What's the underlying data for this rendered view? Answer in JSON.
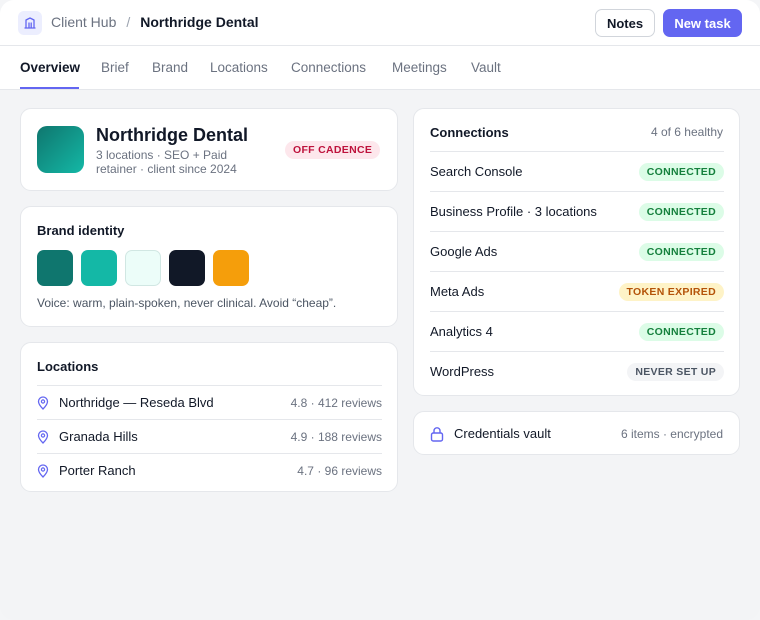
{
  "header": {
    "app_name": "Client Hub",
    "separator": "/",
    "client_name": "Northridge Dental",
    "notes_label": "Notes",
    "new_task_label": "New task"
  },
  "tabs": [
    {
      "label": "Overview",
      "active": true
    },
    {
      "label": "Brief",
      "active": false
    },
    {
      "label": "Brand",
      "active": false
    },
    {
      "label": "Locations",
      "active": false
    },
    {
      "label": "Connections",
      "active": false
    },
    {
      "label": "Meetings",
      "active": false
    },
    {
      "label": "Vault",
      "active": false
    }
  ],
  "profile": {
    "name": "Northridge Dental",
    "subtitle_line1": "3 locations · SEO + Paid",
    "subtitle_line2": "retainer · client since 2024",
    "status": "OFF CADENCE",
    "avatar_colors": [
      "#0f766e",
      "#14b8a6"
    ]
  },
  "brand": {
    "title": "Brand identity",
    "swatches": [
      "#0f766e",
      "#14b8a6",
      "#ecfdf9",
      "#111827",
      "#f59e0b"
    ],
    "voice": "Voice: warm, plain-spoken, never clinical. Avoid “cheap”."
  },
  "locations": {
    "title": "Locations",
    "items": [
      {
        "name": "Northridge — Reseda Blvd",
        "meta": "4.8 · 412 reviews"
      },
      {
        "name": "Granada Hills",
        "meta": "4.9 · 188 reviews"
      },
      {
        "name": "Porter Ranch",
        "meta": "4.7 · 96 reviews"
      }
    ]
  },
  "connections": {
    "title": "Connections",
    "summary": "4 of 6 healthy",
    "items": [
      {
        "name": "Search Console",
        "status": "CONNECTED",
        "kind": "connected"
      },
      {
        "name": "Business Profile · 3 locations",
        "status": "CONNECTED",
        "kind": "connected"
      },
      {
        "name": "Google Ads",
        "status": "CONNECTED",
        "kind": "connected"
      },
      {
        "name": "Meta Ads",
        "status": "TOKEN EXPIRED",
        "kind": "expired"
      },
      {
        "name": "Analytics 4",
        "status": "CONNECTED",
        "kind": "connected"
      },
      {
        "name": "WordPress",
        "status": "NEVER SET UP",
        "kind": "never"
      }
    ]
  },
  "vault": {
    "title": "Credentials vault",
    "meta": "6 items · encrypted"
  },
  "colors": {
    "accent": "#6366f1",
    "connected": "#15803d",
    "expired": "#b45309",
    "off_cadence": "#be123c"
  }
}
